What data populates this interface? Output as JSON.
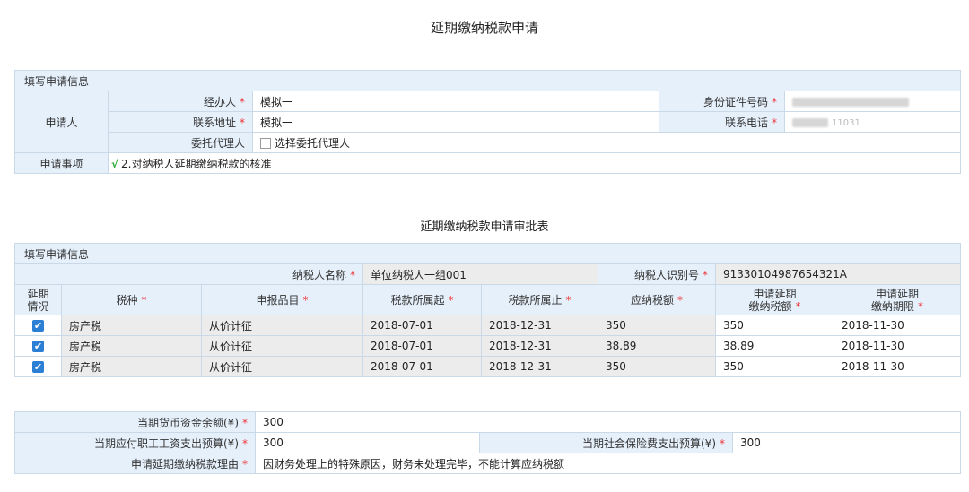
{
  "page": {
    "title": "延期缴纳税款申请",
    "approval_title": "延期缴纳税款申请审批表"
  },
  "applicant": {
    "section_label": "填写申请信息",
    "group_label": "申请人",
    "agent_label": "经办人",
    "agent_value": "模拟一",
    "id_label": "身份证件号码",
    "address_label": "联系地址",
    "address_value": "模拟一",
    "phone_label": "联系电话",
    "phone_value_tail": "11031",
    "proxy_label": "委托代理人",
    "proxy_checkbox_label": "选择委托代理人",
    "matter_label": "申请事项",
    "matter_value": "2.对纳税人延期缴纳税款的核准",
    "required_mark": "*"
  },
  "approval": {
    "section_label": "填写申请信息",
    "taxpayer_name_label": "纳税人名称",
    "taxpayer_name_value": "单位纳税人一组001",
    "taxpayer_id_label": "纳税人识别号",
    "taxpayer_id_value": "91330104987654321A",
    "headers": {
      "status": [
        "延期",
        "情况"
      ],
      "tax_type": "税种",
      "item": "申报品目",
      "period_start": "税款所属起",
      "period_end": "税款所属止",
      "amount_due": "应纳税额",
      "deferred_amount": [
        "申请延期",
        "缴纳税额"
      ],
      "deferred_deadline": [
        "申请延期",
        "缴纳期限"
      ]
    },
    "rows": [
      {
        "tax_type": "房产税",
        "item": "从价计征",
        "period_start": "2018-07-01",
        "period_end": "2018-12-31",
        "amount_due": "350",
        "deferred_amount": "350",
        "deferred_deadline": "2018-11-30"
      },
      {
        "tax_type": "房产税",
        "item": "从价计征",
        "period_start": "2018-07-01",
        "period_end": "2018-12-31",
        "amount_due": "38.89",
        "deferred_amount": "38.89",
        "deferred_deadline": "2018-11-30"
      },
      {
        "tax_type": "房产税",
        "item": "从价计征",
        "period_start": "2018-07-01",
        "period_end": "2018-12-31",
        "amount_due": "350",
        "deferred_amount": "350",
        "deferred_deadline": "2018-11-30"
      }
    ]
  },
  "funds": {
    "cash_balance_label": "当期货币资金余额(¥)",
    "cash_balance_value": "300",
    "payroll_label": "当期应付职工工资支出预算(¥)",
    "payroll_value": "300",
    "social_label": "当期社会保险费支出预算(¥)",
    "social_value": "300",
    "reason_label": "申请延期缴纳税款理由",
    "reason_value": "因财务处理上的特殊原因，财务未处理完毕，不能计算应纳税额"
  },
  "colors": {
    "header_bg": "#e6f0fb",
    "border": "#c9d9e8",
    "checkbox": "#2b7fd4",
    "required": "#e33333",
    "check_green": "#27a82f"
  }
}
